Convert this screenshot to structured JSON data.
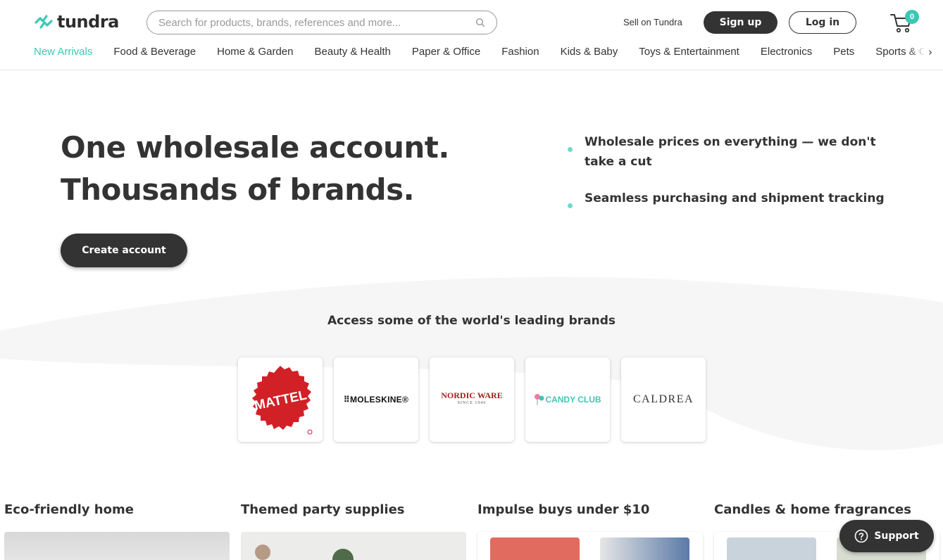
{
  "header": {
    "logo_text": "tundra",
    "search_placeholder": "Search for products, brands, references and more...",
    "sell_link": "Sell on Tundra",
    "signup_label": "Sign up",
    "login_label": "Log in",
    "cart_count": "0"
  },
  "nav": {
    "items": [
      {
        "label": "New Arrivals"
      },
      {
        "label": "Food & Beverage"
      },
      {
        "label": "Home & Garden"
      },
      {
        "label": "Beauty & Health"
      },
      {
        "label": "Paper & Office"
      },
      {
        "label": "Fashion"
      },
      {
        "label": "Kids & Baby"
      },
      {
        "label": "Toys & Entertainment"
      },
      {
        "label": "Electronics"
      },
      {
        "label": "Pets"
      },
      {
        "label": "Sports & Outdoors"
      }
    ],
    "more_arrow": "›"
  },
  "hero": {
    "title_line1": "One wholesale account.",
    "title_line2": "Thousands of brands.",
    "cta_label": "Create account",
    "bullets": [
      "Wholesale prices on everything — we don't take a cut",
      "Seamless purchasing and shipment tracking"
    ]
  },
  "brands": {
    "title": "Access some of the world's leading brands",
    "items": [
      {
        "name": "MATTEL"
      },
      {
        "name": "MOLESKINE"
      },
      {
        "name": "NORDIC WARE",
        "sub": "SINCE 1946"
      },
      {
        "name": "CANDY CLUB"
      },
      {
        "name": "CALDREA"
      }
    ]
  },
  "categories": [
    {
      "title": "Eco-friendly home"
    },
    {
      "title": "Themed party supplies"
    },
    {
      "title": "Impulse buys under $10"
    },
    {
      "title": "Candles & home fragrances"
    }
  ],
  "support": {
    "label": "Support"
  },
  "colors": {
    "accent": "#3cc7b5",
    "dark": "#333333",
    "mattel_red": "#d22027"
  }
}
